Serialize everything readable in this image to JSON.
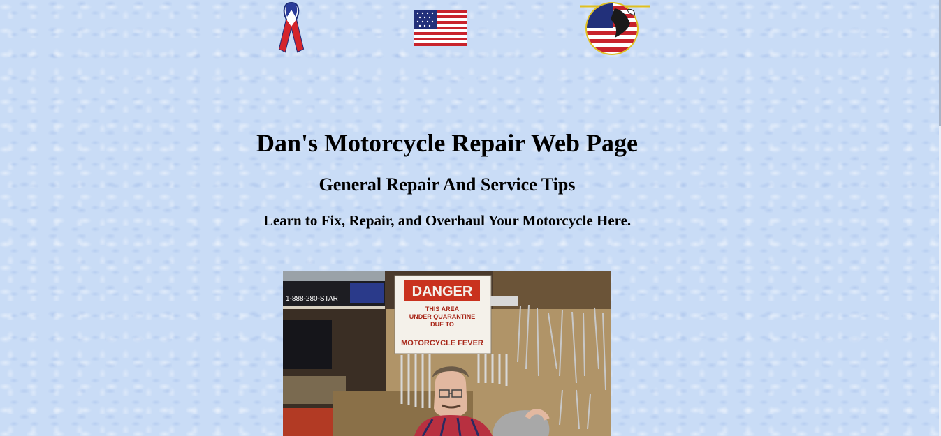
{
  "header": {
    "title": "Dan's Motorcycle Repair Web Page",
    "subtitle": "General Repair And Service Tips",
    "tagline": "Learn to Fix, Repair, and Overhaul Your Motorcycle Here."
  },
  "icons": {
    "ribbon": "ribbon-icon",
    "flag": "american-flag-icon",
    "eagle": "eagle-badge-icon"
  },
  "photo": {
    "banner_phone": "1-888-280-STAR",
    "sign_heading": "DANGER",
    "sign_line1": "THIS AREA",
    "sign_line2": "UNDER QUARANTINE",
    "sign_line3": "DUE TO",
    "sign_line4": "MOTORCYCLE FEVER"
  },
  "colors": {
    "background": "#c9dcf6",
    "sign_red": "#c9321e",
    "sign_white": "#f4f1ea"
  }
}
